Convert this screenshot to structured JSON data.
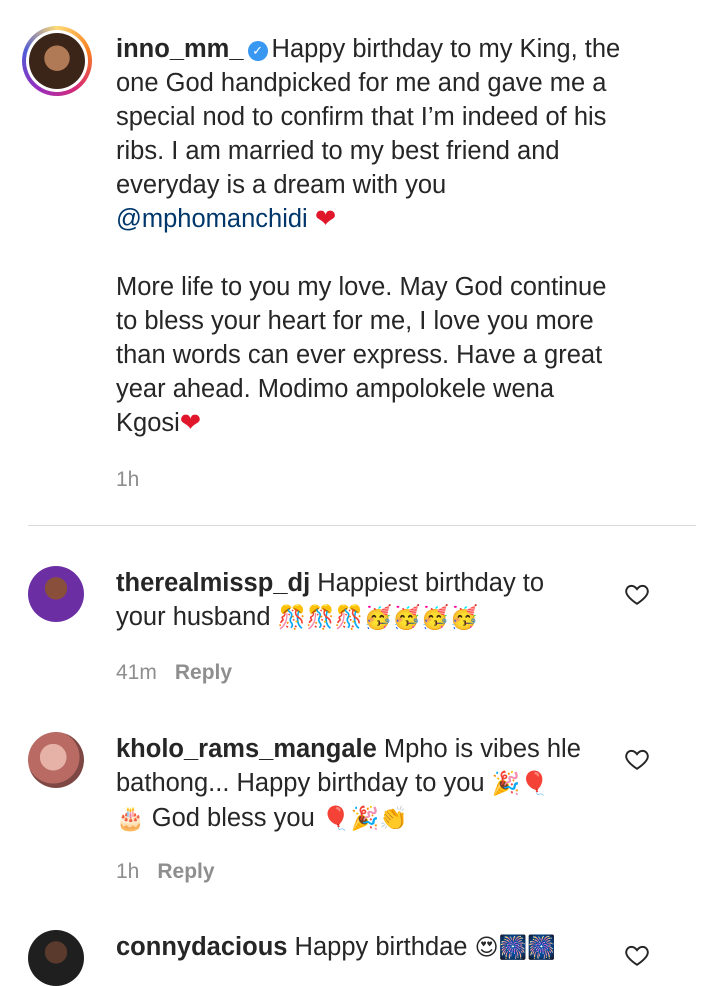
{
  "post": {
    "username": "inno_mm_",
    "line1": "Happy birthday to my King, the",
    "line2": "one God handpicked for me and gave me a",
    "line3": "special nod to confirm that I’m indeed of his",
    "line4": "ribs. I am married to my best friend and",
    "line5": "everyday is a dream with you",
    "mention": "@mphomanchidi",
    "heart": "❤",
    "p2_line1": "More life to you my love. May God continue",
    "p2_line2": "to bless your heart for me, I love you more",
    "p2_line3": "than words can ever express. Have a great",
    "p2_line4": "year ahead. Modimo ampolokele wena",
    "p2_line5": "Kgosi",
    "time": "1h"
  },
  "comments": [
    {
      "username": "therealmissp_dj",
      "line1": "Happiest birthday to",
      "line2": "your husband",
      "emojis": "🎊🎊🎊🥳🥳🥳🥳",
      "time": "41m",
      "reply": "Reply"
    },
    {
      "username": "kholo_rams_mangale",
      "line1": "Mpho is vibes hle",
      "line2": "bathong... Happy birthday to you",
      "line2_emojis": "🎉🎈",
      "line3_pre": "🎂",
      "line3": "God bless you",
      "line3_emojis": "🎈🎉👏",
      "time": "1h",
      "reply": "Reply"
    },
    {
      "username": "connydacious",
      "line1": "Happy birthdae",
      "emojis": "😍🎆🎆"
    }
  ]
}
